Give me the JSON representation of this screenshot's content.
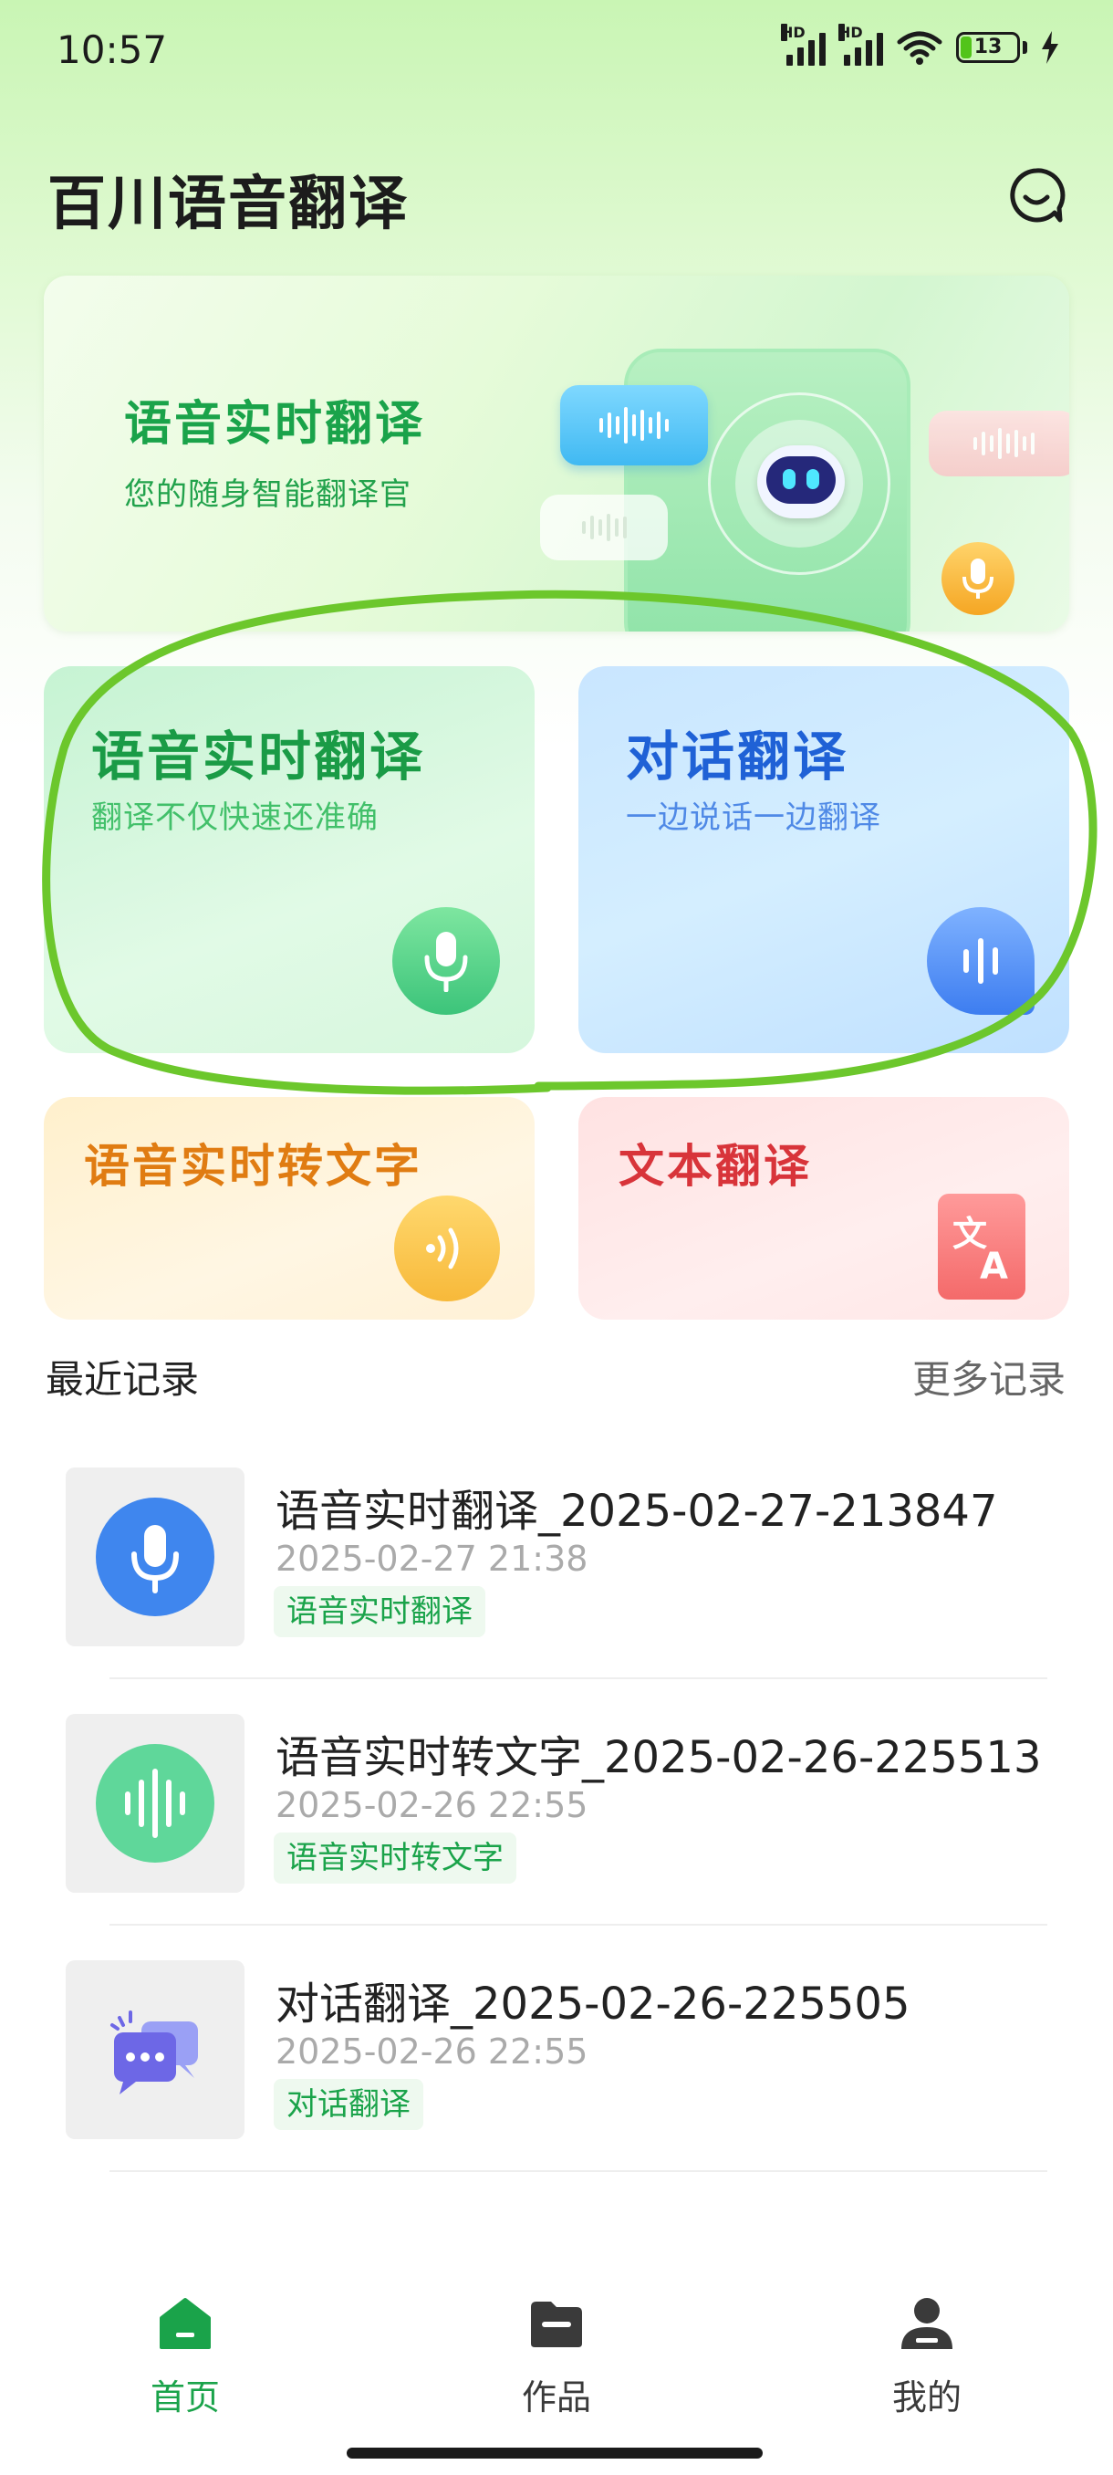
{
  "status_bar": {
    "time": "10:57",
    "battery": "13",
    "network_badge": "HD"
  },
  "header": {
    "title": "百川语音翻译",
    "chat_icon": "chat-bubble-smile-icon"
  },
  "banner": {
    "title": "语音实时翻译",
    "subtitle": "您的随身智能翻译官"
  },
  "features": [
    {
      "title": "语音实时翻译",
      "subtitle": "翻译不仅快速还准确",
      "icon": "microphone-icon",
      "color": "#1a9b46"
    },
    {
      "title": "对话翻译",
      "subtitle": "一边说话一边翻译",
      "icon": "voice-wave-icon",
      "color": "#1f61d6"
    },
    {
      "title": "语音实时转文字",
      "icon": "sound-waves-icon",
      "color": "#e07c12"
    },
    {
      "title": "文本翻译",
      "icon": "translate-icon",
      "color": "#d8343a"
    }
  ],
  "recent": {
    "title": "最近记录",
    "more": "更多记录",
    "items": [
      {
        "title": "语音实时翻译_2025-02-27-213847",
        "time": "2025-02-27 21:38",
        "tag": "语音实时翻译",
        "icon": "microphone-icon"
      },
      {
        "title": "语音实时转文字_2025-02-26-225513",
        "time": "2025-02-26 22:55",
        "tag": "语音实时转文字",
        "icon": "sound-wave-icon"
      },
      {
        "title": "对话翻译_2025-02-26-225505",
        "time": "2025-02-26 22:55",
        "tag": "对话翻译",
        "icon": "chat-bubbles-icon"
      }
    ]
  },
  "nav": {
    "items": [
      {
        "label": "首页",
        "icon": "home-icon",
        "active": true
      },
      {
        "label": "作品",
        "icon": "folder-icon",
        "active": false
      },
      {
        "label": "我的",
        "icon": "user-icon",
        "active": false
      }
    ]
  },
  "colors": {
    "accent": "#1aa34a",
    "annotation": "#6cc72c"
  }
}
